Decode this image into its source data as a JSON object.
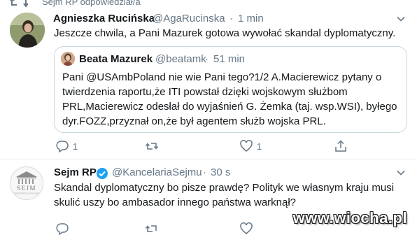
{
  "retweet_header": {
    "text": "Sejm RP odpowiedział/a",
    "icon": "retweet-icon"
  },
  "tweet1": {
    "name": "Agnieszka Rucińska",
    "handle": "@AgaRucinska",
    "sep": "·",
    "time": "1 min",
    "text": "Jeszcze chwila, a Pani Mazurek gotowa wywołać skandal dyplomatyczny.",
    "quote": {
      "name": "Beata Mazurek",
      "handle": "@beatamk",
      "sep": "·",
      "time": "51 min",
      "lines": [
        "Pani @USAmbPoland nie wie Pani tego?1/2 A.Macierewicz pytany o",
        "twierdzenia raportu,że ITI powstał dzięki wojskowym służbom",
        "PRL,Macierewicz odesłał do wyjaśnień G. Żemka (taj. wsp.WSI), byłego",
        "dyr.FOZZ,przyznał on,że był agentem służb wojska PRL."
      ]
    },
    "actions": {
      "reply_count": "1",
      "like_count": "1"
    }
  },
  "tweet2": {
    "name": "Sejm RP",
    "handle": "@KancelariaSejmu",
    "sep": "·",
    "time": "30 s",
    "lines": [
      "Skandal dyplomatyczny bo pisze prawdę? Polityk we własnym kraju musi",
      "skulić uszy bo ambasador innego państwa warknął?"
    ],
    "logo_text": "SEJM",
    "logo_subtext": "RZECZPOSPOLITEJ POLSKIEJ"
  },
  "watermark": "www.wiocha.pl",
  "colors": {
    "secondary_text": "#657786",
    "verified": "#1da1f2",
    "border": "#ccd6dd"
  }
}
